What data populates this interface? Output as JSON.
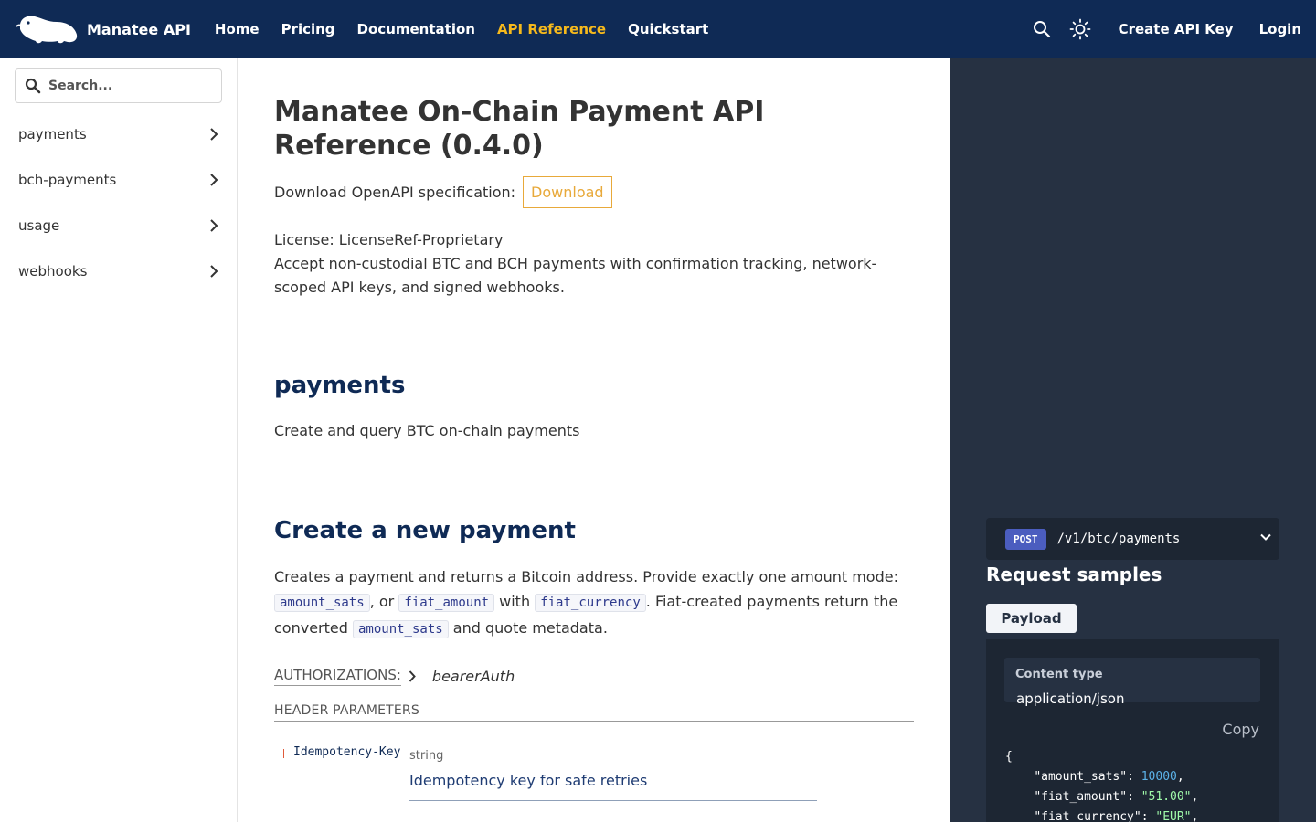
{
  "navbar": {
    "brand": "Manatee API",
    "links": [
      {
        "label": "Home",
        "active": false
      },
      {
        "label": "Pricing",
        "active": false
      },
      {
        "label": "Documentation",
        "active": false
      },
      {
        "label": "API Reference",
        "active": true
      },
      {
        "label": "Quickstart",
        "active": false
      }
    ],
    "icons": [
      "search-icon",
      "sun-icon"
    ],
    "create_key": "Create API Key",
    "login": "Login",
    "colors": {
      "background": "#0f2a55",
      "active": "#f6b91c"
    }
  },
  "sidebar": {
    "search_placeholder": "Search...",
    "items": [
      {
        "label": "payments"
      },
      {
        "label": "bch-payments"
      },
      {
        "label": "usage"
      },
      {
        "label": "webhooks"
      }
    ]
  },
  "content": {
    "title": "Manatee On-Chain Payment API Reference (0.4.0)",
    "download_prefix": "Download OpenAPI specification:",
    "download_label": "Download",
    "license": "License: LicenseRef-Proprietary",
    "description": "Accept non-custodial BTC and BCH payments with confirmation tracking, network-scoped API keys, and signed webhooks.",
    "section_title": "payments",
    "section_desc": "Create and query BTC on-chain payments",
    "op_title": "Create a new payment",
    "op_desc": {
      "part1": "Creates a payment and returns a Bitcoin address. Provide exactly one amount mode: ",
      "code1": "amount_sats",
      "part2": ", or ",
      "code2": "fiat_amount",
      "part3": " with ",
      "code3": "fiat_currency",
      "part4": ". Fiat-created payments return the converted ",
      "code4": "amount_sats",
      "part5": " and quote metadata."
    },
    "auth_label": "AUTHORIZATIONS:",
    "auth_value": "bearerAuth",
    "header_params_label": "HEADER PARAMETERS",
    "param": {
      "name": "Idempotency-Key",
      "type": "string",
      "description": "Idempotency key for safe retries"
    }
  },
  "right_panel": {
    "method": "POST",
    "path": "/v1/btc/payments",
    "request_samples": "Request samples",
    "payload_tab": "Payload",
    "content_type_label": "Content type",
    "content_type_value": "application/json",
    "copy": "Copy",
    "json_lines": [
      {
        "text": "{"
      },
      {
        "key": "\"amount_sats\"",
        "value": "10000",
        "kind": "n"
      },
      {
        "key": "\"fiat_amount\"",
        "value": "\"51.00\"",
        "kind": "s"
      },
      {
        "key": "\"fiat_currency\"",
        "value": "\"EUR\"",
        "kind": "s"
      }
    ],
    "colors": {
      "background": "#263142",
      "badge": "#4b5dbf"
    }
  }
}
